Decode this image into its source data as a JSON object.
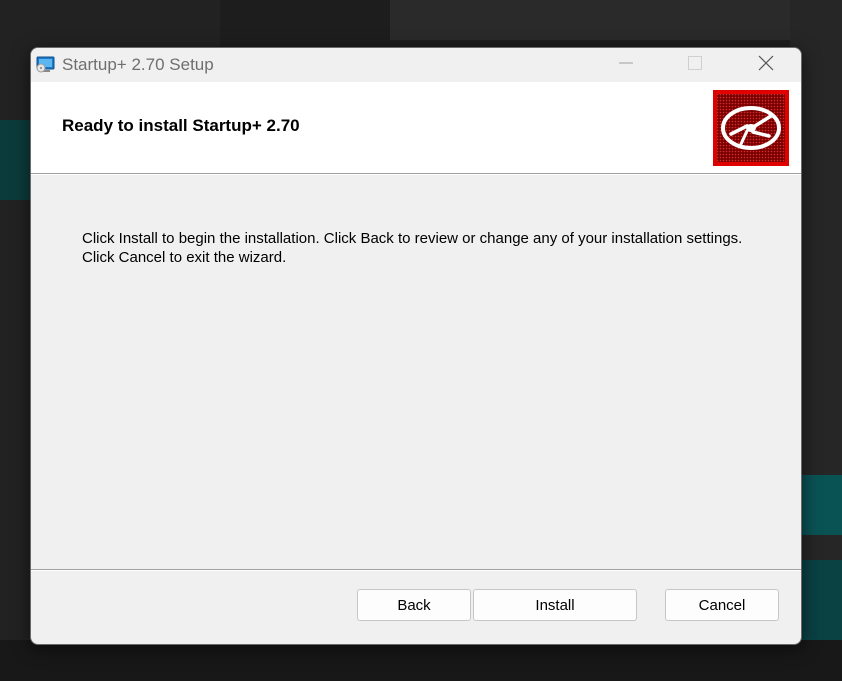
{
  "window": {
    "title": "Startup+ 2.70 Setup"
  },
  "header": {
    "title": "Ready to install Startup+ 2.70",
    "logo_icon": "disc-icon",
    "logo_color": "#d40000"
  },
  "body": {
    "text": "Click Install to begin the installation. Click Back to review or change any of your installation settings. Click Cancel to exit the wizard."
  },
  "buttons": {
    "back": "Back",
    "install": "Install",
    "cancel": "Cancel"
  },
  "icons": {
    "app": "installer-monitor-icon",
    "minimize": "minimize-icon",
    "maximize": "maximize-icon",
    "close": "close-icon"
  }
}
